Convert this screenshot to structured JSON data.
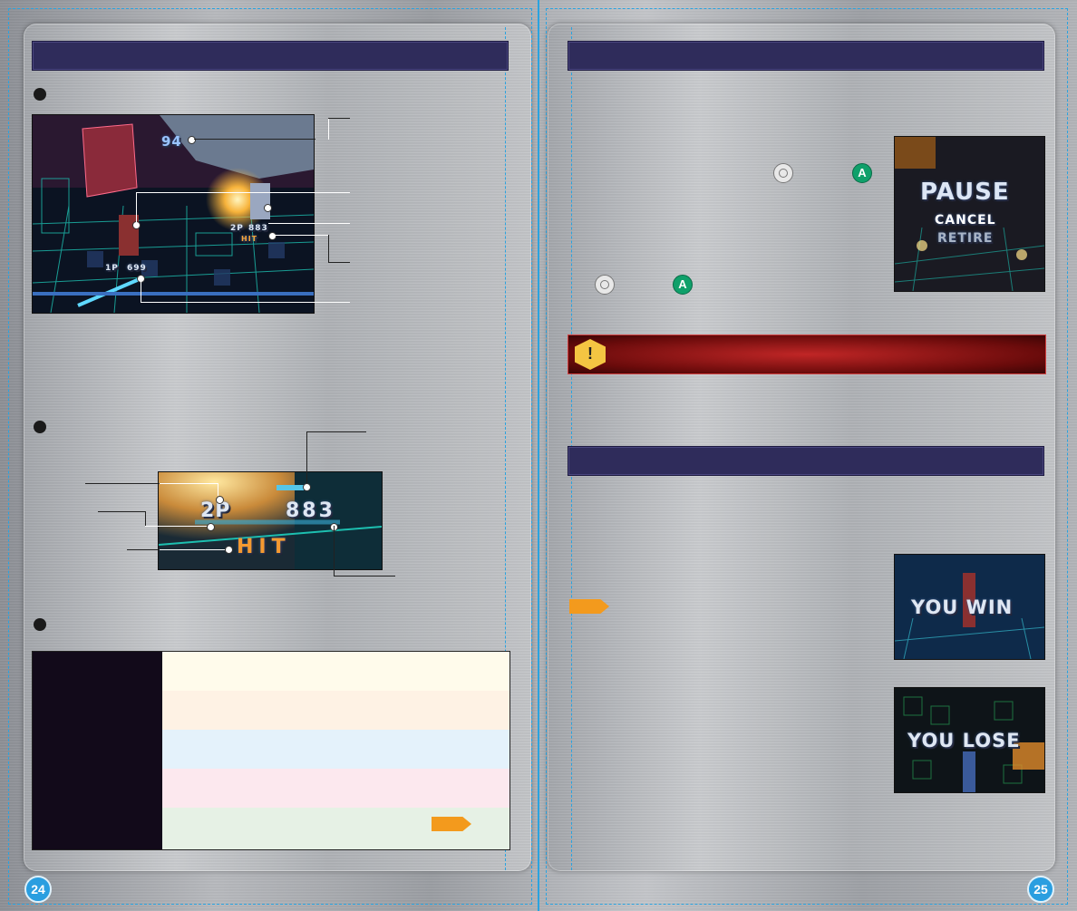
{
  "pages": {
    "left_number": "24",
    "right_number": "25"
  },
  "screens": {
    "hud_timer": "94",
    "hud_p2_tag": "2P",
    "hud_p2_value": "883",
    "hud_p2_hit": "HIT",
    "hud_p1_tag": "1P",
    "hud_p1_value": "699",
    "zoom_player_tag": "2P",
    "zoom_damage": "883",
    "zoom_hit": "HIT",
    "pause_title": "PAUSE",
    "pause_option_cancel": "CANCEL",
    "pause_option_retire": "RETIRE",
    "win_text": "YOU WIN",
    "lose_text": "YOU LOSE"
  },
  "buttons": {
    "a_button": "A"
  },
  "warning": {
    "icon": "!"
  },
  "colors": {
    "section_bar": "#2f2c5b",
    "accent_blue": "#2aa3e0",
    "button_green": "#0fa06a",
    "arrow_orange": "#f39a1d",
    "warning_red": "#c02626",
    "table_row_1": "#fffbeb",
    "table_row_2": "#fef2e4",
    "table_row_3": "#e4f2fb",
    "table_row_4": "#fce8ee",
    "table_row_5": "#e6f1e5"
  },
  "icons": [
    "circle-pad-icon",
    "a-button-icon",
    "warning-icon",
    "next-arrow-icon"
  ]
}
